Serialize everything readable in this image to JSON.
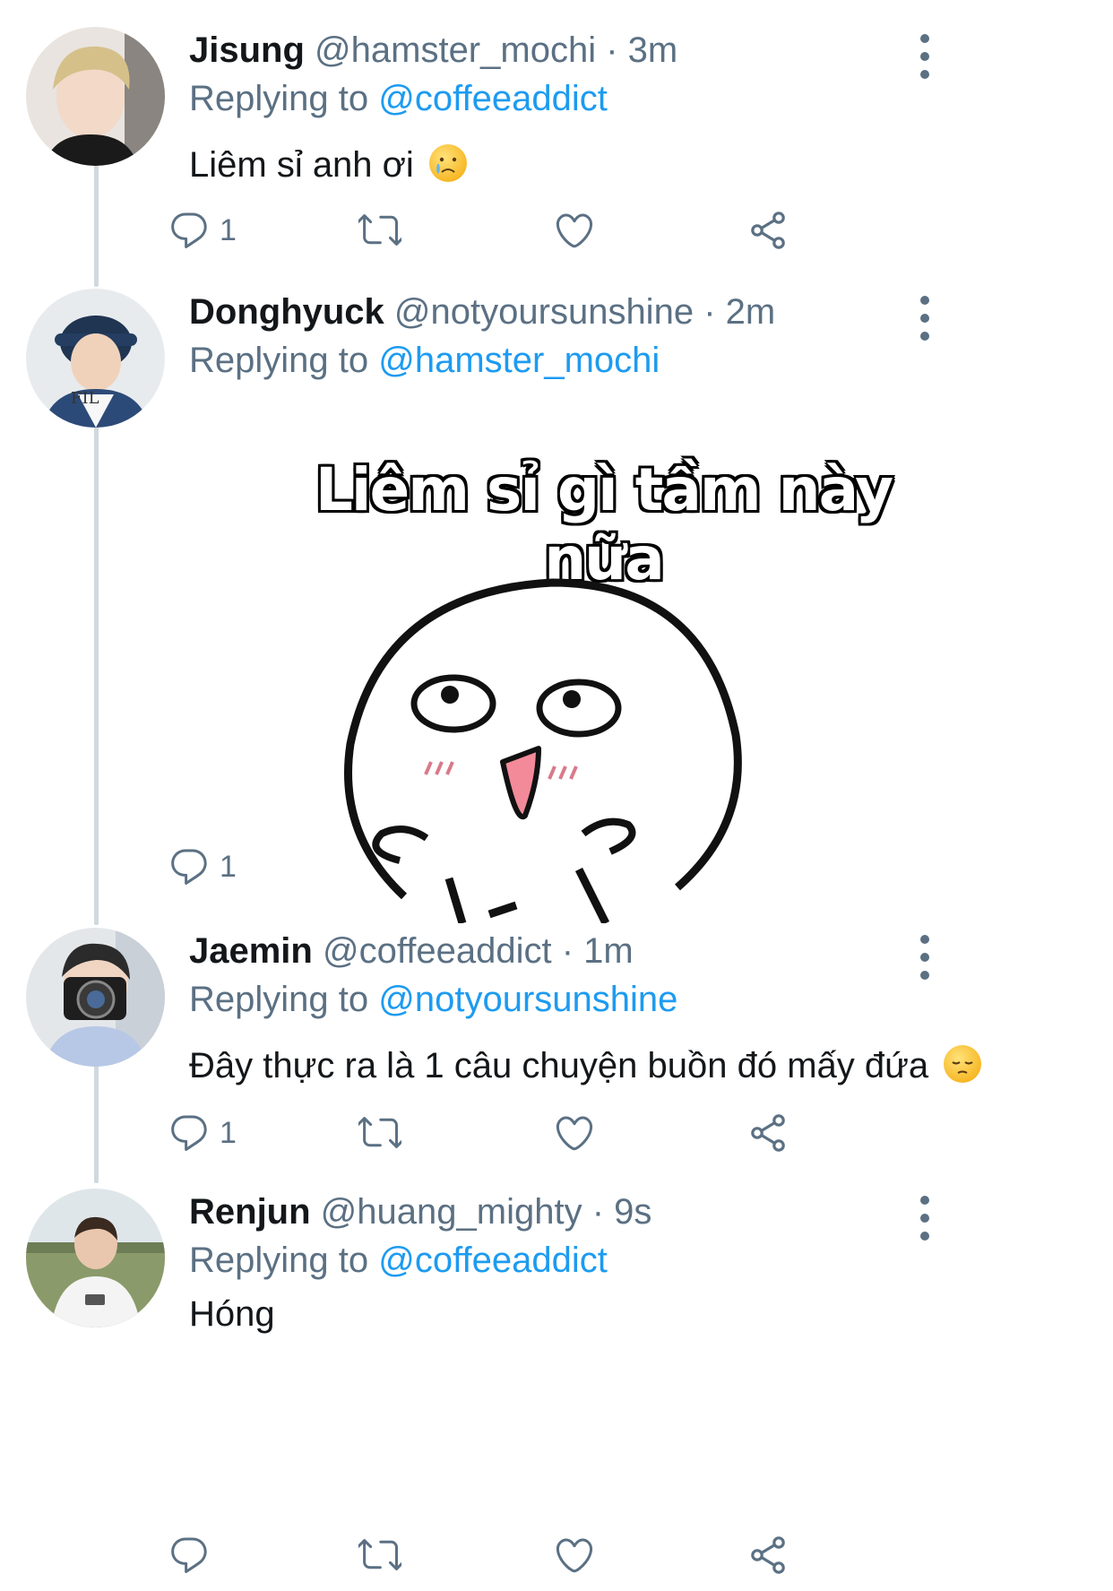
{
  "tweets": [
    {
      "name": "Jisung",
      "handle": "@hamster_mochi",
      "time": "3m",
      "replying_label": "Replying to",
      "replying_to": "@coffeeaddict",
      "text": "Liêm sỉ anh ơi",
      "emoji": "crying-face",
      "reply_count": "1"
    },
    {
      "name": "Donghyuck",
      "handle": "@notyoursunshine",
      "time": "2m",
      "replying_label": "Replying to",
      "replying_to": "@hamster_mochi",
      "media_caption": "Liêm sỉ gì tầm này nữa",
      "reply_count": "1"
    },
    {
      "name": "Jaemin",
      "handle": "@coffeeaddict",
      "time": "1m",
      "replying_label": "Replying to",
      "replying_to": "@notyoursunshine",
      "text": "Đây thực ra là 1 câu chuyện buồn đó mấy đứa",
      "emoji": "pensive-face",
      "reply_count": "1"
    },
    {
      "name": "Renjun",
      "handle": "@huang_mighty",
      "time": "9s",
      "replying_label": "Replying to",
      "replying_to": "@coffeeaddict",
      "text": "Hóng",
      "reply_count": ""
    }
  ],
  "separator": "·",
  "colors": {
    "accent": "#1d9bf0",
    "secondary": "#5b7083",
    "thread_line": "#cfd9de"
  },
  "icons": [
    "reply-icon",
    "retweet-icon",
    "like-icon",
    "share-icon",
    "more-options-icon"
  ]
}
